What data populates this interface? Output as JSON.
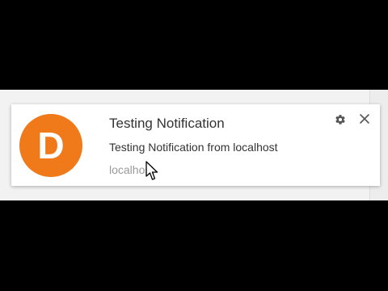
{
  "notification": {
    "avatar_letter": "D",
    "title": "Testing Notification",
    "message": "Testing Notification from localhost",
    "origin": "localhost",
    "settings_icon": "gear-icon",
    "close_icon": "close-icon"
  },
  "colors": {
    "avatar_background": "#f07a1a",
    "avatar_text": "#ffffff",
    "title_text": "#333333",
    "origin_text": "#9a9a9a"
  }
}
